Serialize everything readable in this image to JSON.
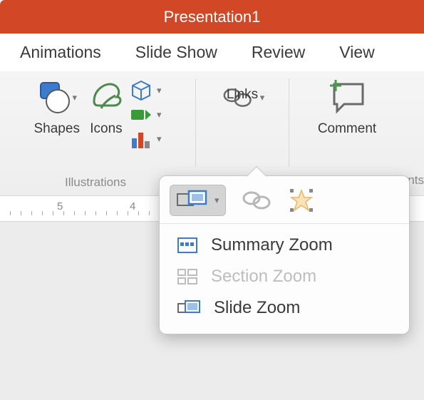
{
  "titlebar": {
    "title": "Presentation1"
  },
  "tabs": {
    "animations": "Animations",
    "slideshow": "Slide Show",
    "review": "Review",
    "view": "View"
  },
  "ribbon": {
    "shapes": "Shapes",
    "icons": "Icons",
    "links": "Links",
    "comment": "Comment",
    "group_illustrations": "Illustrations",
    "group_comments_partial": "ments"
  },
  "ruler": {
    "n5": "5",
    "n4": "4"
  },
  "zoom_menu": {
    "summary": "Summary Zoom",
    "section": "Section Zoom",
    "slide": "Slide Zoom"
  }
}
